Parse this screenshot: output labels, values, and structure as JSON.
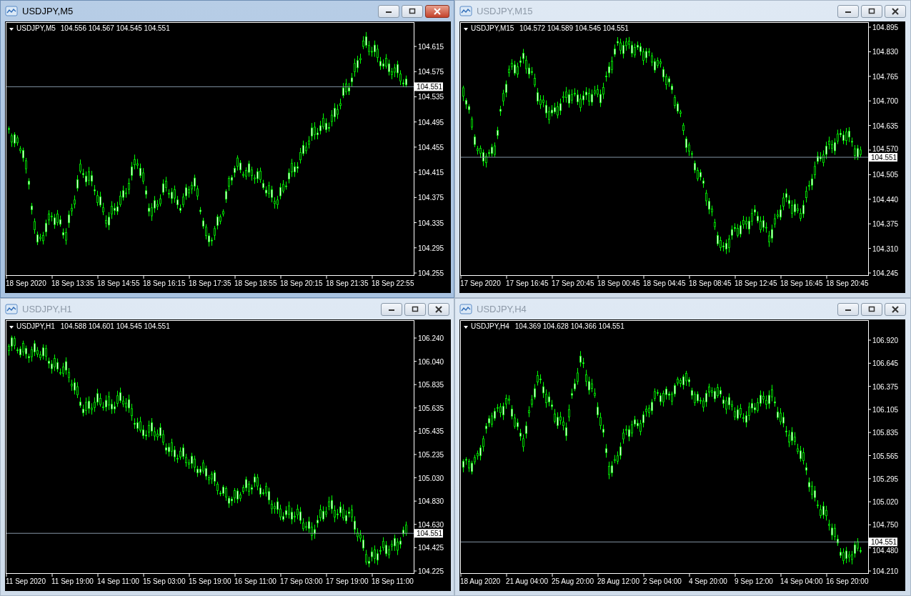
{
  "windows": [
    {
      "title": "USDJPY,M5",
      "active": true,
      "header": {
        "symbol": "USDJPY,M5",
        "quote": "104.556 104.567 104.545 104.551"
      },
      "price_tag": "104.551",
      "yticks": [
        "104.615",
        "104.575",
        "104.535",
        "104.495",
        "104.455",
        "104.415",
        "104.375",
        "104.335",
        "104.295",
        "104.255"
      ],
      "xticks": [
        "18 Sep 2020",
        "18 Sep 13:35",
        "18 Sep 14:55",
        "18 Sep 16:15",
        "18 Sep 17:35",
        "18 Sep 18:55",
        "18 Sep 20:15",
        "18 Sep 21:35",
        "18 Sep 22:55"
      ]
    },
    {
      "title": "USDJPY,M15",
      "active": false,
      "header": {
        "symbol": "USDJPY,M15",
        "quote": "104.572 104.589 104.545 104.551"
      },
      "price_tag": "104.551",
      "yticks": [
        "104.895",
        "104.830",
        "104.765",
        "104.700",
        "104.635",
        "104.570",
        "104.505",
        "104.440",
        "104.375",
        "104.310",
        "104.245"
      ],
      "xticks": [
        "17 Sep 2020",
        "17 Sep 16:45",
        "17 Sep 20:45",
        "18 Sep 00:45",
        "18 Sep 04:45",
        "18 Sep 08:45",
        "18 Sep 12:45",
        "18 Sep 16:45",
        "18 Sep 20:45"
      ]
    },
    {
      "title": "USDJPY,H1",
      "active": false,
      "header": {
        "symbol": "USDJPY,H1",
        "quote": "104.588 104.601 104.545 104.551"
      },
      "price_tag": "104.551",
      "yticks": [
        "106.240",
        "106.040",
        "105.835",
        "105.635",
        "105.435",
        "105.235",
        "105.030",
        "104.830",
        "104.630",
        "104.425",
        "104.225"
      ],
      "xticks": [
        "11 Sep 2020",
        "11 Sep 19:00",
        "14 Sep 11:00",
        "15 Sep 03:00",
        "15 Sep 19:00",
        "16 Sep 11:00",
        "17 Sep 03:00",
        "17 Sep 19:00",
        "18 Sep 11:00"
      ]
    },
    {
      "title": "USDJPY,H4",
      "active": false,
      "header": {
        "symbol": "USDJPY,H4",
        "quote": "104.369 104.628 104.366 104.551"
      },
      "price_tag": "104.551",
      "yticks": [
        "106.920",
        "106.645",
        "106.375",
        "106.105",
        "105.835",
        "105.565",
        "105.295",
        "105.020",
        "104.750",
        "104.480",
        "104.210"
      ],
      "xticks": [
        "18 Aug 2020",
        "21 Aug 04:00",
        "25 Aug 20:00",
        "28 Aug 12:00",
        "2 Sep 04:00",
        "4 Sep 20:00",
        "9 Sep 12:00",
        "14 Sep 04:00",
        "16 Sep 20:00"
      ]
    }
  ]
}
